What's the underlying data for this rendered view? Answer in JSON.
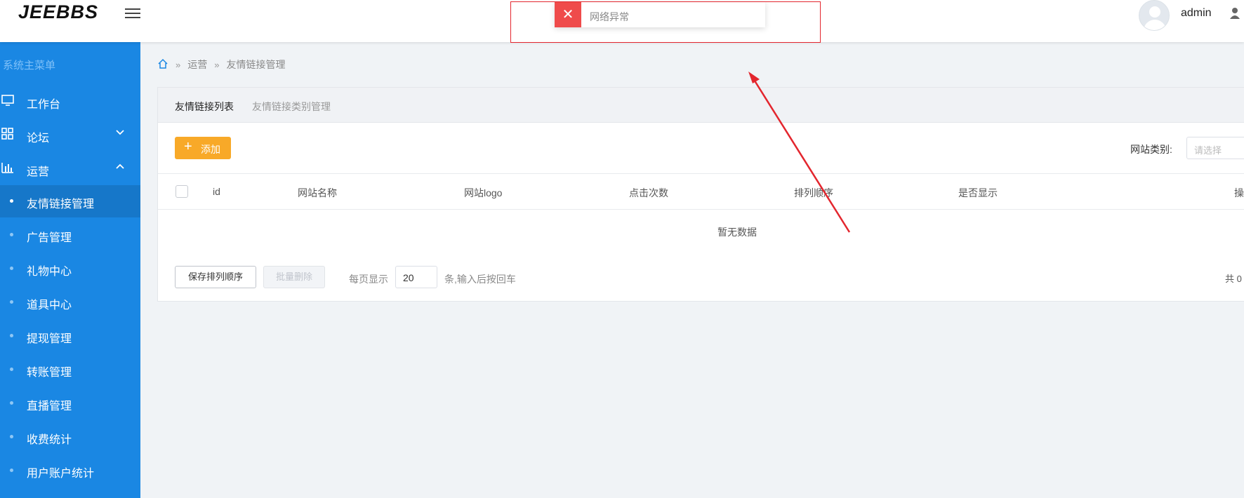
{
  "header": {
    "logo": "JEEBBS",
    "username": "admin"
  },
  "sidebar": {
    "title": "系统主菜单",
    "items": [
      {
        "label": "工作台",
        "icon": "monitor-icon"
      },
      {
        "label": "论坛",
        "icon": "grid-icon"
      },
      {
        "label": "运营",
        "icon": "bar-chart-icon"
      }
    ],
    "sub_items": [
      {
        "label": "友情链接管理",
        "active": true
      },
      {
        "label": "广告管理"
      },
      {
        "label": "礼物中心"
      },
      {
        "label": "道具中心"
      },
      {
        "label": "提现管理"
      },
      {
        "label": "转账管理"
      },
      {
        "label": "直播管理"
      },
      {
        "label": "收费统计"
      },
      {
        "label": "用户账户统计"
      }
    ]
  },
  "breadcrumb": [
    "运营",
    "友情链接管理"
  ],
  "tabs": [
    "友情链接列表",
    "友情链接类别管理"
  ],
  "toolbar": {
    "add_label": "添加",
    "filter_label": "网站类别:",
    "filter_placeholder": "请选择"
  },
  "table": {
    "columns": [
      "id",
      "网站名称",
      "网站logo",
      "点击次数",
      "排列顺序",
      "是否显示",
      "操"
    ],
    "empty_text": "暂无数据"
  },
  "footer": {
    "save_order": "保存排列顺序",
    "batch_delete": "批量删除",
    "per_page_label": "每页显示",
    "per_page_value": "20",
    "per_page_suffix": "条,输入后按回车",
    "total": "共 0"
  },
  "toast": {
    "message": "网络异常"
  },
  "colors": {
    "sidebar": "#1a87e3",
    "accent": "#f8a928",
    "error": "#ef4b4b",
    "annotation": "#e3262e"
  }
}
